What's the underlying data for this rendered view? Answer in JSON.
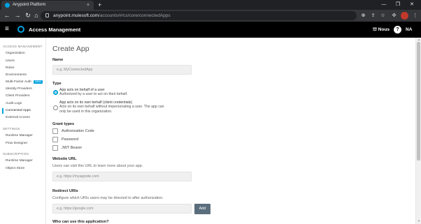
{
  "browser": {
    "tab_title": "Anypoint Platform",
    "tab_close": "×",
    "new_tab": "+",
    "url_host": "anypoint.mulesoft.com",
    "url_path": "/accounts/#/cs/core/connectedApps"
  },
  "header": {
    "title": "Access Management",
    "org": "Nous",
    "help": "?",
    "user": "NA"
  },
  "sidebar": {
    "sections": [
      {
        "title": "ACCESS MANAGEMENT"
      },
      {
        "title": "SETTINGS"
      },
      {
        "title": "SUBSCRIPTION"
      }
    ],
    "items": [
      "Organization",
      "Users",
      "Roles",
      "Environments",
      "Multi-Factor Auth",
      "Identity Providers",
      "Client Providers",
      "Audit Logs",
      "Connected Apps",
      "External Access",
      "Runtime Manager",
      "Flow Designer",
      "Runtime Manager",
      "Object Store"
    ],
    "new_badge": "NEW"
  },
  "form": {
    "page_title": "Create App",
    "name_label": "Name",
    "name_placeholder": "e.g. MyConnectedApp",
    "type_label": "Type",
    "type_option1_title": "App acts on behalf of a user",
    "type_option1_desc": "Authorized by a user to act on their behalf.",
    "type_option2_title": "App acts on its own behalf (client credentials)",
    "type_option2_desc1": "Acts on its own behalf without impersonating a user. The app can",
    "type_option2_desc2": "only be used in this organization.",
    "grant_label": "Grant types",
    "grants": [
      "Authorization Code",
      "Password",
      "JWT Bearer"
    ],
    "website_label": "Website URL",
    "website_help": "Users can visit this URL to learn more about your app.",
    "website_placeholder": "e.g. https://myappsite.com",
    "redirect_label": "Redirect URIs",
    "redirect_help": "Configure which URIs users may be directed to after authorization.",
    "redirect_placeholder": "e.g. https://google.com",
    "add_button": "Add",
    "who_label": "Who can use this application?"
  },
  "colors": {
    "accent": "#00a2df",
    "header_bg": "#000000",
    "add_button": "#5b6e7d"
  }
}
